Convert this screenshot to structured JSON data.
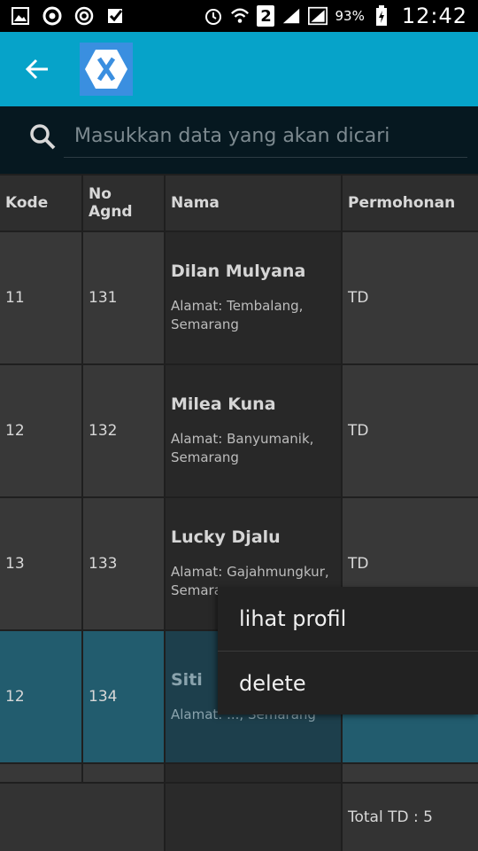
{
  "status_bar": {
    "left_icons": [
      "gallery-icon",
      "chrome-icon",
      "sync-icon",
      "check-icon"
    ],
    "sim_number": "2",
    "battery_percent": "93%",
    "time": "12:42"
  },
  "app_bar": {
    "back_icon": "arrow-left-icon",
    "logo_letter": "X",
    "accent_color": "#06a3c9"
  },
  "search": {
    "placeholder": "Masukkan data yang akan dicari",
    "value": ""
  },
  "table": {
    "headers": [
      "Kode",
      "No Agnd",
      "Nama",
      "Permohonan"
    ],
    "rows": [
      {
        "kode": "11",
        "no_agnd": "131",
        "nama": "Dilan Mulyana",
        "alamat": "Alamat: Tembalang, Semarang",
        "permohonan": "TD"
      },
      {
        "kode": "12",
        "no_agnd": "132",
        "nama": "Milea Kuna",
        "alamat": "Alamat: Banyumanik, Semarang",
        "permohonan": "TD"
      },
      {
        "kode": "13",
        "no_agnd": "133",
        "nama": "Lucky Djalu",
        "alamat": "Alamat: Gajahmungkur, Semarang",
        "permohonan": "TD"
      },
      {
        "kode": "12",
        "no_agnd": "134",
        "nama": "Siti",
        "alamat": "Alamat: ..., Semarang",
        "permohonan": ""
      }
    ],
    "total": "Total TD : 5"
  },
  "context_menu": {
    "items": [
      "lihat profil",
      "delete"
    ]
  }
}
